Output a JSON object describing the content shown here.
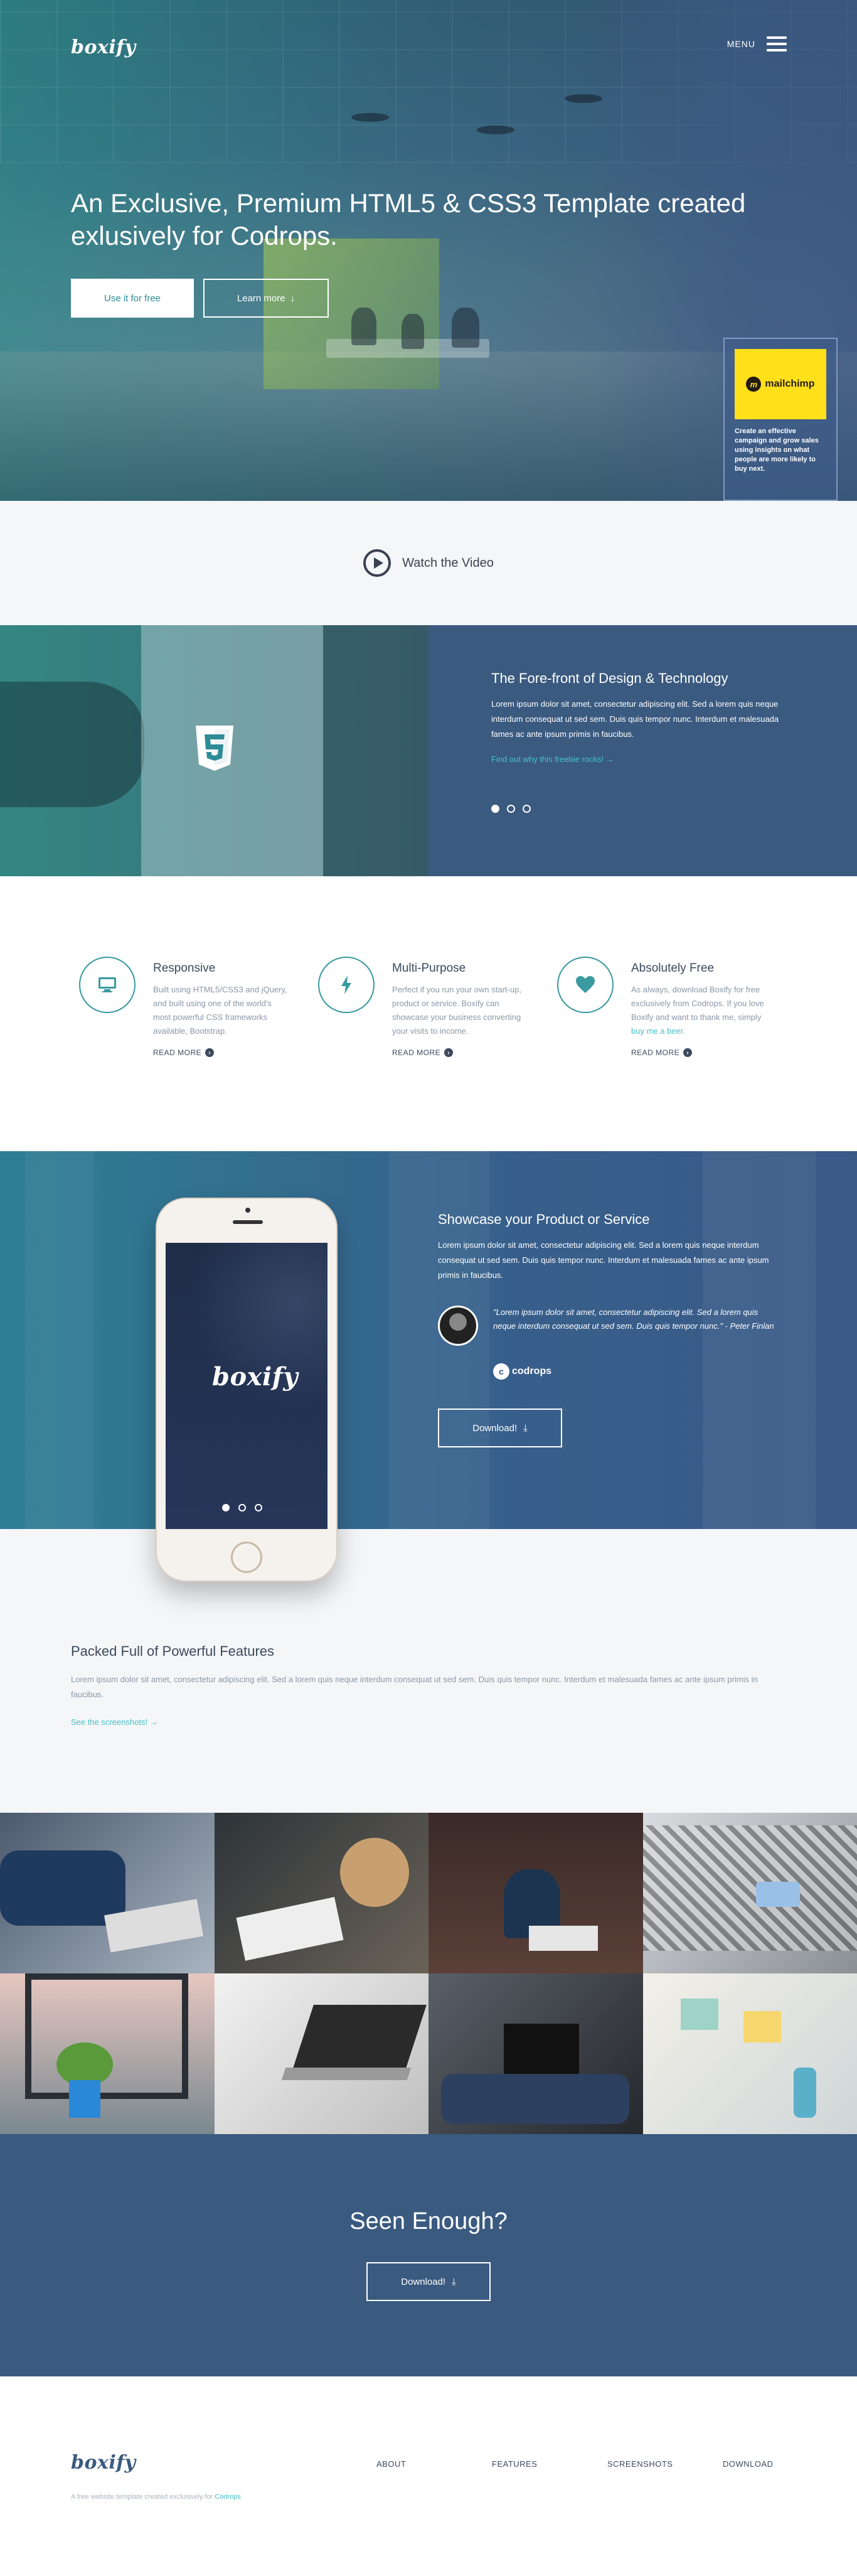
{
  "brand": "boxify",
  "nav": {
    "menu_label": "MENU"
  },
  "hero": {
    "headline": "An Exclusive, Premium HTML5 & CSS3 Template created exlusively for Codrops.",
    "primary_button": "Use it for free",
    "secondary_button": "Learn more",
    "ad": {
      "logo_text": "mailchimp",
      "text": "Create an effective campaign and grow sales using insights on what people are more likely to buy next."
    }
  },
  "video": {
    "label": "Watch the Video"
  },
  "slider": {
    "title": "The Fore-front of Design & Technology",
    "body": "Lorem ipsum dolor sit amet, consectetur adipiscing elit. Sed a lorem quis neque interdum consequat ut sed sem. Duis quis tempor nunc. Interdum et malesuada fames ac ante ipsum primis in faucibus.",
    "link": "Find out why this freebie rocks! →",
    "slides": 3,
    "active_slide": 1
  },
  "features": [
    {
      "title": "Responsive",
      "body": "Built using HTML5/CSS3 and jQuery, and built using one of the world's most powerful CSS frameworks available, Bootstrap.",
      "link": "READ MORE",
      "icon": "monitor-icon"
    },
    {
      "title": "Multi-Purpose",
      "body": "Perfect if you run your own start-up, product or service. Boxify can showcase your business converting your visits to income.",
      "link": "READ MORE",
      "icon": "lightning-icon"
    },
    {
      "title": "Absolutely Free",
      "body_before": "As always, download Boxify for free exclusively from Codrops. If you love Boxify and want to thank me, simply ",
      "body_link": "buy me a beer.",
      "link": "READ MORE",
      "icon": "heart-icon"
    }
  ],
  "showcase": {
    "title": "Showcase your Product or Service",
    "body": "Lorem ipsum dolor sit amet, consectetur adipiscing elit. Sed a lorem quis neque interdum consequat ut sed sem. Duis quis tempor nunc. Interdum et malesuada fames ac ante ipsum primis in faucibus.",
    "quote": "\"Lorem ipsum dolor sit amet, consectetur adipiscing elit. Sed a lorem quis neque interdum consequat ut sed sem. Duis quis tempor nunc.\" - Peter Finlan",
    "partner": "codrops",
    "button": "Download!"
  },
  "packed": {
    "title": "Packed Full of Powerful Features",
    "body": "Lorem ipsum dolor sit amet, consectetur adipiscing elit. Sed a lorem quis neque interdum consequat ut sed sem. Duis quis tempor nunc. Interdum et malesuada fames ac ante ipsum primis in faucibus.",
    "link": "See the screenshots! →"
  },
  "cta": {
    "title": "Seen Enough?",
    "button": "Download!"
  },
  "footer": {
    "tagline_before": "A free website template created exclusively for ",
    "tagline_link": "Codrops",
    "nav": [
      "ABOUT",
      "FEATURES",
      "SCREENSHOTS",
      "DOWNLOAD"
    ]
  },
  "colors": {
    "accent": "#49c0c8",
    "navy": "#3a5a80",
    "teal": "#2e8c97",
    "mailchimp_yellow": "#ffe01b"
  }
}
